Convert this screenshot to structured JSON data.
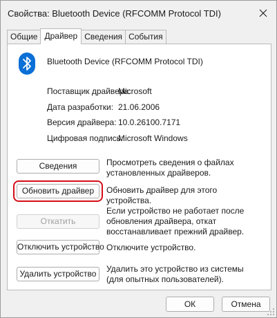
{
  "window": {
    "title": "Свойства: Bluetooth Device (RFCOMM Protocol TDI)"
  },
  "tabs": [
    {
      "label": "Общие",
      "active": false
    },
    {
      "label": "Драйвер",
      "active": true
    },
    {
      "label": "Сведения",
      "active": false
    },
    {
      "label": "События",
      "active": false
    }
  ],
  "device": {
    "name": "Bluetooth Device (RFCOMM Protocol TDI)",
    "icon": "bluetooth-icon",
    "icon_color": "#0a6fd6"
  },
  "driver_info": [
    {
      "label": "Поставщик драйвера:",
      "value": "Microsoft"
    },
    {
      "label": "Дата разработки:",
      "value": "21.06.2006"
    },
    {
      "label": "Версия драйвера:",
      "value": "10.0.26100.7171"
    },
    {
      "label": "Цифровая подпись:",
      "value": "Microsoft Windows"
    }
  ],
  "actions": [
    {
      "button": "Сведения",
      "description": "Просмотреть сведения о файлах установленных драйверов.",
      "enabled": true
    },
    {
      "button": "Обновить драйвер",
      "description": "Обновить драйвер для этого устройства.",
      "enabled": true,
      "highlighted": true,
      "highlight_color": "#d40e17"
    },
    {
      "button": "Откатить",
      "description": "Если устройство не работает после обновления драйвера, откат восстанавливает прежний драйвер.",
      "enabled": false
    },
    {
      "button": "Отключить устройство",
      "description": "Отключите устройство.",
      "enabled": true
    },
    {
      "button": "Удалить устройство",
      "description": "Удалить это устройство из системы (для опытных пользователей).",
      "enabled": true
    }
  ],
  "footer": {
    "ok": "ОК",
    "cancel": "Отмена"
  }
}
